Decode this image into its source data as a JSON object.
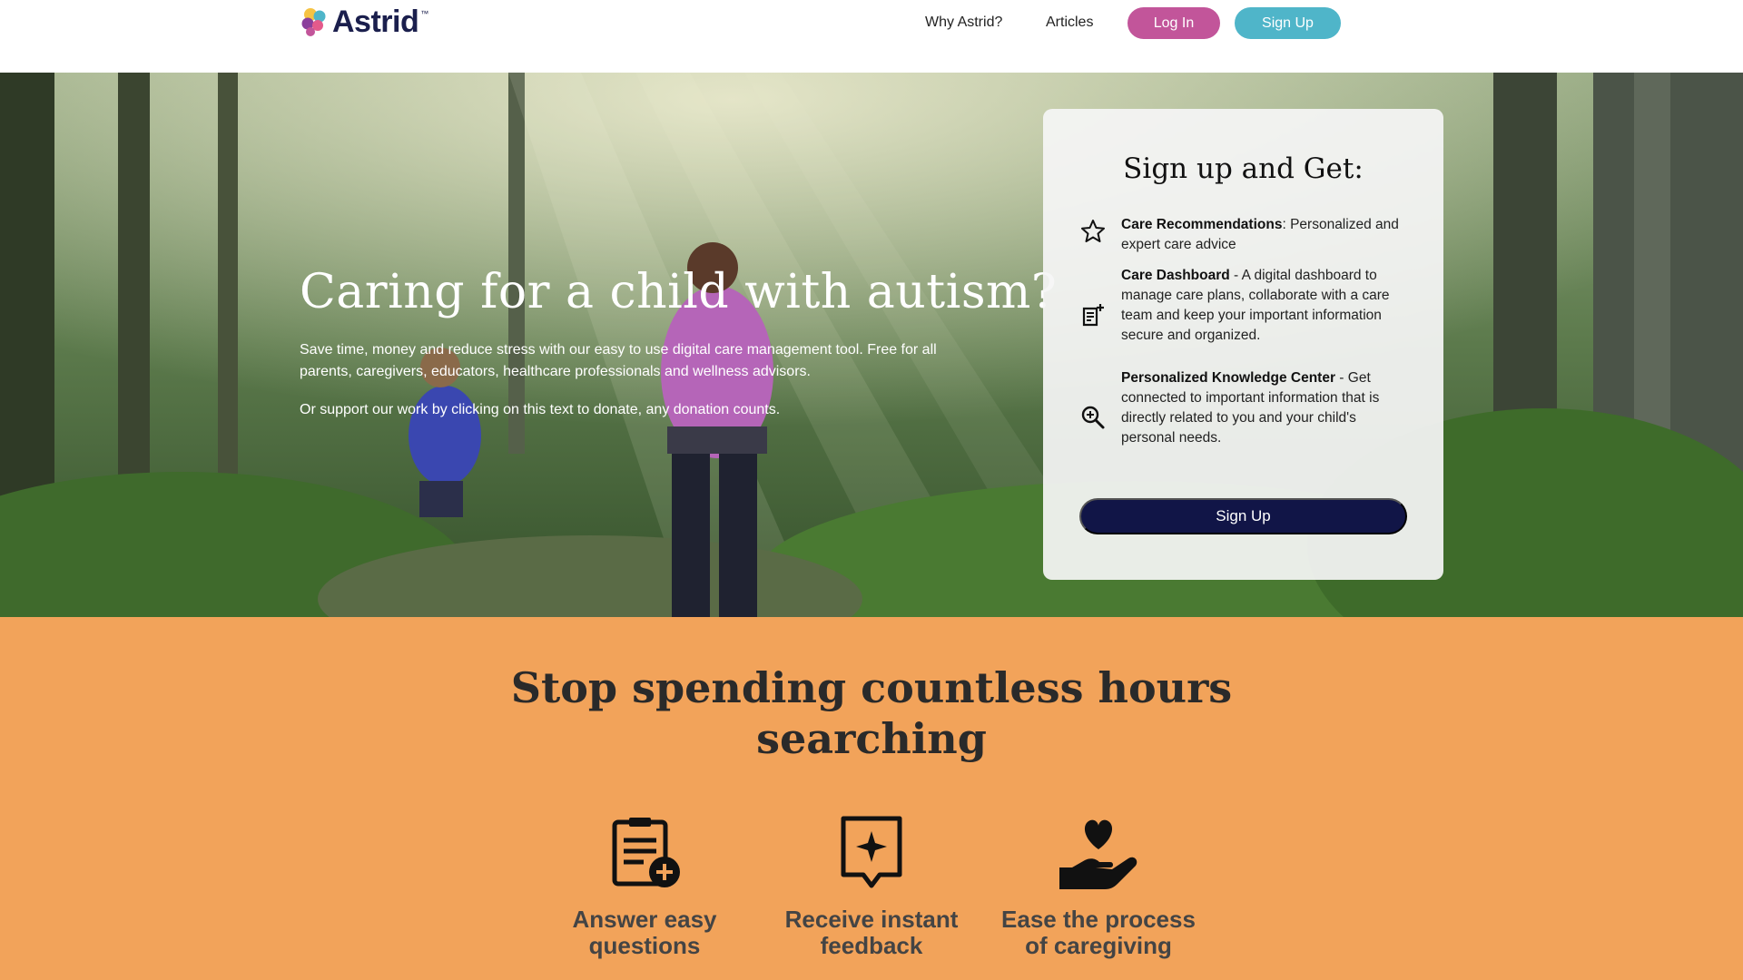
{
  "nav": {
    "logo_text": "Astrid",
    "logo_tm": "™",
    "links": [
      "Why Astrid?",
      "Articles"
    ],
    "login_label": "Log In",
    "signup_label": "Sign Up"
  },
  "hero": {
    "title": "Caring for a child with autism?",
    "description": "Save time, money and reduce stress with our easy to use digital care management tool. Free for all parents, caregivers, educators, healthcare professionals and wellness advisors.",
    "donate_text": "Or support our work by clicking on this text to donate, any donation counts."
  },
  "card": {
    "title": "Sign up and Get:",
    "features": [
      {
        "icon": "star-icon",
        "name": "Care Recommendations",
        "sep": ": ",
        "text": "Personalized and expert care advice"
      },
      {
        "icon": "dashboard-note-icon",
        "name": "Care Dashboard",
        "sep": " - ",
        "text": "A digital dashboard to manage care plans, collaborate with a care team and keep your important information secure and organized."
      },
      {
        "icon": "magnify-plus-icon",
        "name": "Personalized Knowledge Center",
        "sep": " - ",
        "text": "Get connected to important information that is directly related to you and your child's personal needs."
      }
    ],
    "button_label": "Sign Up"
  },
  "section": {
    "title": "Stop spending countless hours searching",
    "steps": [
      {
        "icon": "clipboard-plus-icon",
        "label": "Answer easy questions"
      },
      {
        "icon": "sparkle-badge-icon",
        "label": "Receive instant feedback"
      },
      {
        "icon": "heart-hand-icon",
        "label": "Ease the process of caregiving"
      }
    ]
  },
  "colors": {
    "login": "#c2559a",
    "signup": "#4fb5c9",
    "card_button": "#111547",
    "section_bg": "#f2a35a"
  }
}
